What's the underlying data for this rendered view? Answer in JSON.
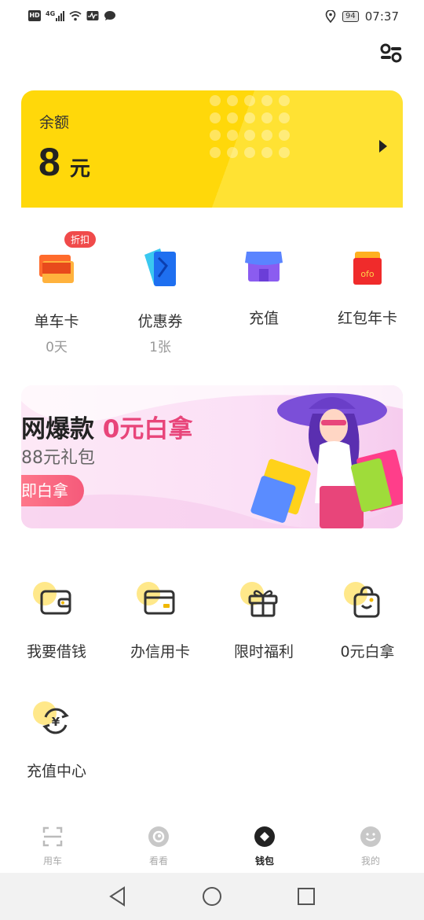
{
  "status_bar": {
    "hd": "HD",
    "network": "4G",
    "battery": "94",
    "time": "07:37"
  },
  "balance": {
    "label": "余额",
    "amount": "8",
    "unit": "元"
  },
  "quick_actions": [
    {
      "label": "单车卡",
      "sub": "0天",
      "badge": "折扣",
      "icon": "bike-card-icon"
    },
    {
      "label": "优惠券",
      "sub": "1张",
      "icon": "coupon-icon"
    },
    {
      "label": "充值",
      "sub": "",
      "icon": "recharge-store-icon"
    },
    {
      "label": "红包年卡",
      "sub": "",
      "icon": "red-packet-icon"
    }
  ],
  "banner": {
    "title_prefix": "网爆款 ",
    "title_highlight": "0元白拿",
    "subtitle": "88元礼包",
    "button": "即白拿"
  },
  "services": [
    {
      "label": "我要借钱",
      "icon": "wallet-icon"
    },
    {
      "label": "办信用卡",
      "icon": "credit-card-icon"
    },
    {
      "label": "限时福利",
      "icon": "gift-icon"
    },
    {
      "label": "0元白拿",
      "icon": "shopping-bag-icon"
    },
    {
      "label": "充值中心",
      "icon": "yuan-exchange-icon"
    }
  ],
  "tabbar": [
    {
      "label": "用车",
      "icon": "scan-icon",
      "active": false
    },
    {
      "label": "看看",
      "icon": "eye-icon",
      "active": false
    },
    {
      "label": "钱包",
      "icon": "wallet-diamond-icon",
      "active": true
    },
    {
      "label": "我的",
      "icon": "smile-icon",
      "active": false
    }
  ],
  "colors": {
    "brand_yellow": "#ffd80a",
    "accent_pink": "#e8457a",
    "badge_red": "#f04a4a"
  }
}
